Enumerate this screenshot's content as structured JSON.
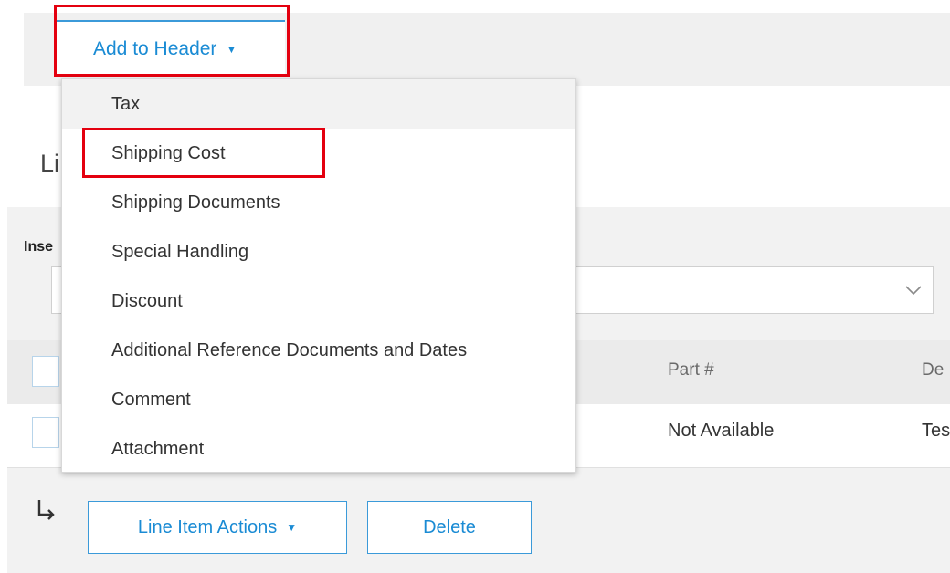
{
  "header_toolbar": {
    "add_to_header_label": "Add to Header",
    "caret": "▼"
  },
  "section": {
    "title_visible_fragment": "Li"
  },
  "insert": {
    "label_fragment": "Inse"
  },
  "table": {
    "columns": [
      "Part #",
      "De"
    ],
    "rows": [
      {
        "part": "Not Available",
        "description_fragment": "Tes"
      }
    ]
  },
  "footer_actions": {
    "line_item_actions_label": "Line Item Actions",
    "caret": "▼",
    "delete_label": "Delete"
  },
  "dropdown_menu": {
    "items": [
      "Tax",
      "Shipping Cost",
      "Shipping Documents",
      "Special Handling",
      "Discount",
      "Additional Reference Documents and Dates",
      "Comment",
      "Attachment"
    ],
    "hovered_item": "Tax",
    "highlighted_item": "Shipping Cost"
  },
  "colors": {
    "accent_blue": "#1a8bd4",
    "highlight_red": "#e4000f"
  },
  "icons": {
    "add_caret": "chevron-down-icon",
    "select_chevron": "chevron-down-icon",
    "child_arrow": "arrow-down-right-icon"
  }
}
